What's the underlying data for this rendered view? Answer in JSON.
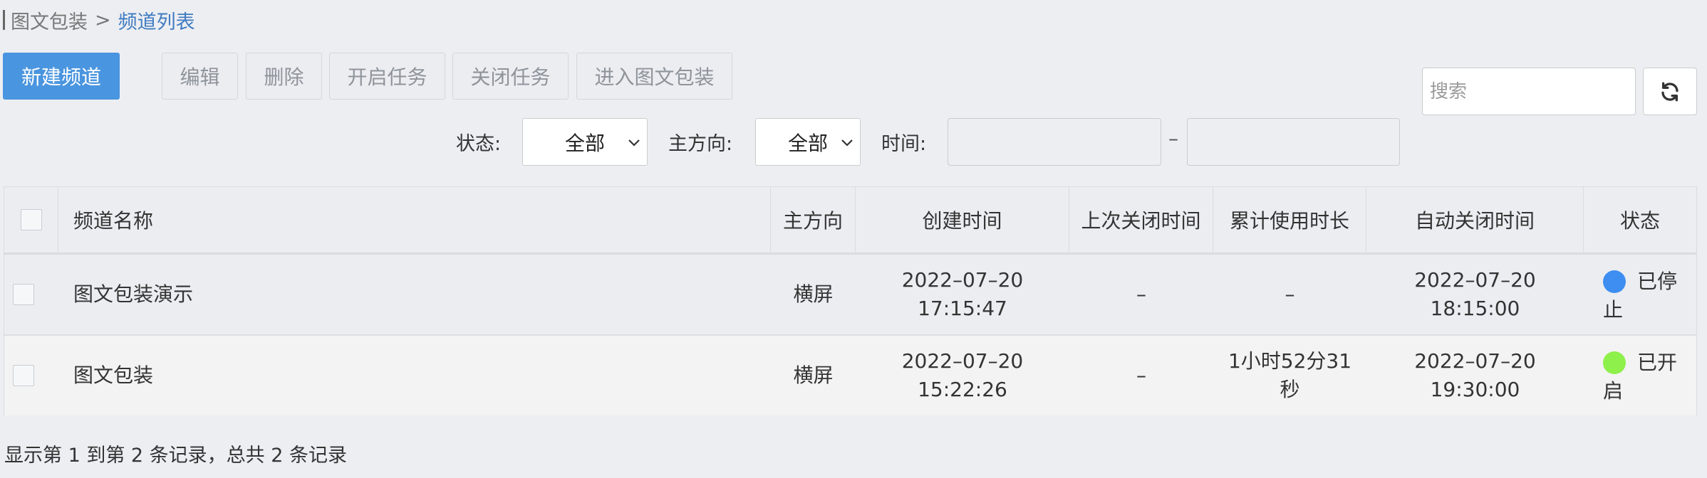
{
  "breadcrumb": {
    "home": "图文包装",
    "separator": ">",
    "current": "频道列表"
  },
  "toolbar": {
    "new_channel": "新建频道",
    "edit": "编辑",
    "delete": "删除",
    "start_task": "开启任务",
    "close_task": "关闭任务",
    "enter_package": "进入图文包装"
  },
  "search": {
    "placeholder": "搜索"
  },
  "filters": {
    "status_label": "状态:",
    "status_value": "全部",
    "direction_label": "主方向:",
    "direction_value": "全部",
    "time_label": "时间:",
    "time_separator": "–"
  },
  "table": {
    "columns": [
      "频道名称",
      "主方向",
      "创建时间",
      "上次关闭时间",
      "累计使用时长",
      "自动关闭时间",
      "状态"
    ],
    "rows": [
      {
        "name": "图文包装演示",
        "direction": "横屏",
        "created_date": "2022–07–20",
        "created_time": "17:15:47",
        "last_closed": "–",
        "total_usage": "–",
        "auto_close_date": "2022–07–20",
        "auto_close_time": "18:15:00",
        "status": "已停止",
        "status_color": "#3d8ef0"
      },
      {
        "name": "图文包装",
        "direction": "横屏",
        "created_date": "2022–07–20",
        "created_time": "15:22:26",
        "last_closed": "–",
        "total_usage": "1小时52分31秒",
        "auto_close_date": "2022–07–20",
        "auto_close_time": "19:30:00",
        "status": "已开启",
        "status_color": "#8ef04a"
      }
    ]
  },
  "footer": {
    "summary": "显示第 1 到第 2 条记录，总共 2 条记录"
  },
  "colors": {
    "accent": "#4a95df",
    "breadcrumb_current": "#3f7bc1"
  }
}
